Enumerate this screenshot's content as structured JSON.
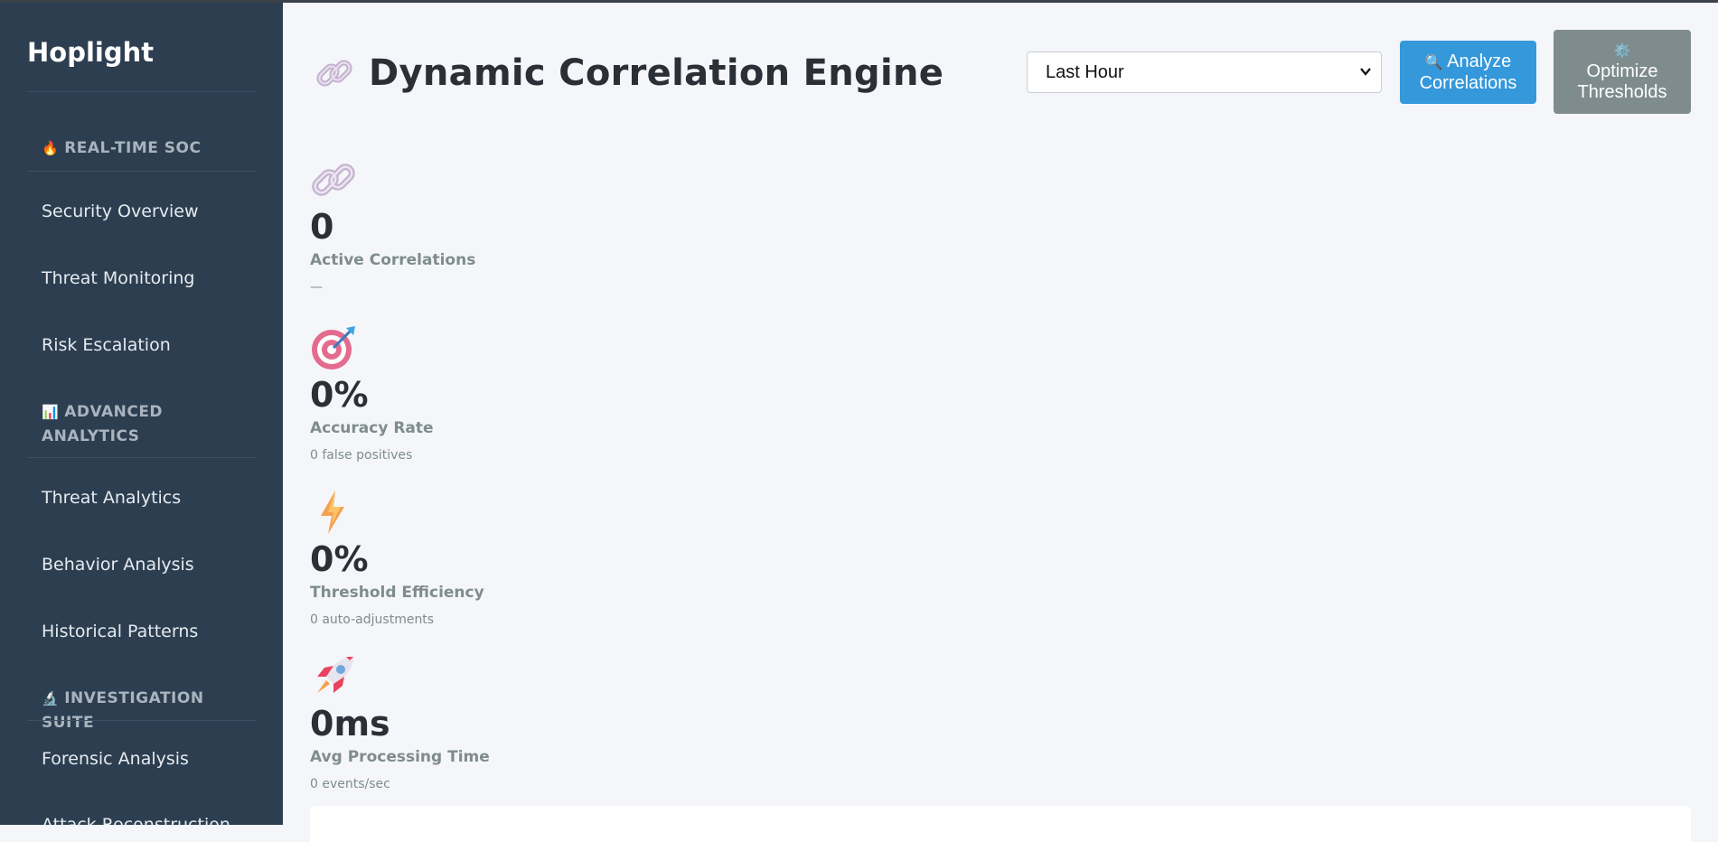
{
  "sidebar": {
    "brand": "Hoplight",
    "sections": [
      {
        "title": "REAL-TIME SOC",
        "icon": "fire-icon"
      },
      {
        "title": "ADVANCED ANALYTICS",
        "icon": "bar-chart-icon"
      },
      {
        "title": "INVESTIGATION SUITE",
        "icon": "microscope-icon"
      }
    ],
    "items": [
      {
        "label": "Security Overview"
      },
      {
        "label": "Threat Monitoring"
      },
      {
        "label": "Risk Escalation"
      },
      {
        "label": "Threat Analytics"
      },
      {
        "label": "Behavior Analysis"
      },
      {
        "label": "Historical Patterns"
      },
      {
        "label": "Forensic Analysis"
      },
      {
        "label": "Attack Reconstruction"
      }
    ]
  },
  "header": {
    "title": "Dynamic Correlation Engine",
    "title_icon": "link-icon",
    "range_select": {
      "selected": "Last Hour"
    },
    "analyze_button": {
      "line1": "Analyze",
      "line2": "Correlations",
      "icon": "magnifier-icon"
    },
    "optimize_button": {
      "line1": "Optimize",
      "line2": "Thresholds",
      "icon": "gear-icon"
    }
  },
  "stats": [
    {
      "icon": "link-icon",
      "value": "0",
      "label": "Active Correlations",
      "sub": "—"
    },
    {
      "icon": "target-icon",
      "value": "0%",
      "label": "Accuracy Rate",
      "sub": "0 false positives"
    },
    {
      "icon": "lightning-icon",
      "value": "0%",
      "label": "Threshold Efficiency",
      "sub": "0 auto-adjustments"
    },
    {
      "icon": "rocket-icon",
      "value": "0ms",
      "label": "Avg Processing Time",
      "sub": "0 events/sec"
    }
  ],
  "colors": {
    "sidebar_bg": "#2c3e50",
    "page_bg": "#f4f6f9",
    "analyze_btn": "#3498db",
    "optimize_btn": "#7f8c8d"
  }
}
